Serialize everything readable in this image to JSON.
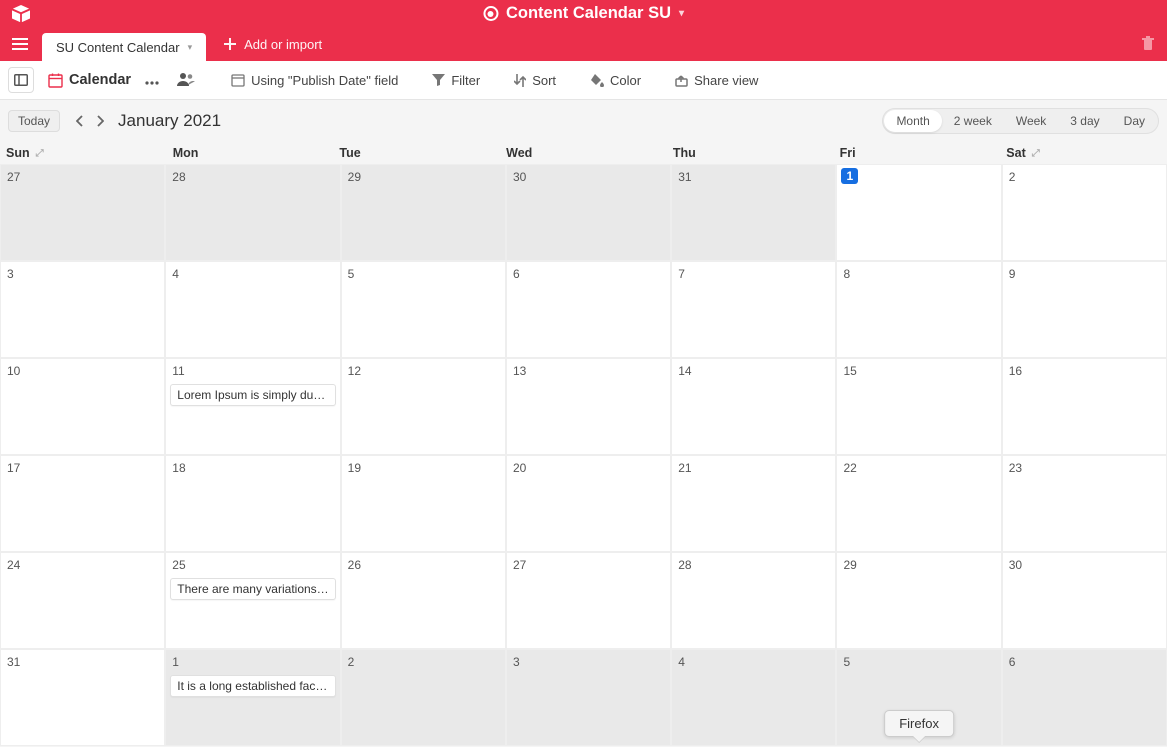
{
  "header": {
    "workspace_title": "Content Calendar SU",
    "tab_name": "SU Content Calendar",
    "add_import": "Add or import"
  },
  "toolbar": {
    "view_name": "Calendar",
    "using_field": "Using \"Publish Date\" field",
    "filter": "Filter",
    "sort": "Sort",
    "color": "Color",
    "share": "Share view"
  },
  "calnav": {
    "today": "Today",
    "month_title": "January 2021",
    "views": {
      "month": "Month",
      "two_week": "2 week",
      "week": "Week",
      "three_day": "3 day",
      "day": "Day"
    }
  },
  "days": {
    "sun": "Sun",
    "mon": "Mon",
    "tue": "Tue",
    "wed": "Wed",
    "thu": "Thu",
    "fri": "Fri",
    "sat": "Sat"
  },
  "grid": [
    [
      {
        "n": "27",
        "o": true
      },
      {
        "n": "28",
        "o": true
      },
      {
        "n": "29",
        "o": true
      },
      {
        "n": "30",
        "o": true
      },
      {
        "n": "31",
        "o": true
      },
      {
        "n": "1",
        "today": true
      },
      {
        "n": "2"
      }
    ],
    [
      {
        "n": "3"
      },
      {
        "n": "4"
      },
      {
        "n": "5"
      },
      {
        "n": "6"
      },
      {
        "n": "7"
      },
      {
        "n": "8"
      },
      {
        "n": "9"
      }
    ],
    [
      {
        "n": "10"
      },
      {
        "n": "11",
        "ev": "Lorem Ipsum is simply du…"
      },
      {
        "n": "12"
      },
      {
        "n": "13"
      },
      {
        "n": "14"
      },
      {
        "n": "15"
      },
      {
        "n": "16"
      }
    ],
    [
      {
        "n": "17"
      },
      {
        "n": "18"
      },
      {
        "n": "19"
      },
      {
        "n": "20"
      },
      {
        "n": "21"
      },
      {
        "n": "22"
      },
      {
        "n": "23"
      }
    ],
    [
      {
        "n": "24"
      },
      {
        "n": "25",
        "ev": "There are many variations…"
      },
      {
        "n": "26"
      },
      {
        "n": "27"
      },
      {
        "n": "28"
      },
      {
        "n": "29"
      },
      {
        "n": "30"
      }
    ],
    [
      {
        "n": "31"
      },
      {
        "n": "1",
        "o": true,
        "ev": "It is a long established fac…"
      },
      {
        "n": "2",
        "o": true
      },
      {
        "n": "3",
        "o": true
      },
      {
        "n": "4",
        "o": true
      },
      {
        "n": "5",
        "o": true,
        "tip": "Firefox"
      },
      {
        "n": "6",
        "o": true
      }
    ]
  ]
}
